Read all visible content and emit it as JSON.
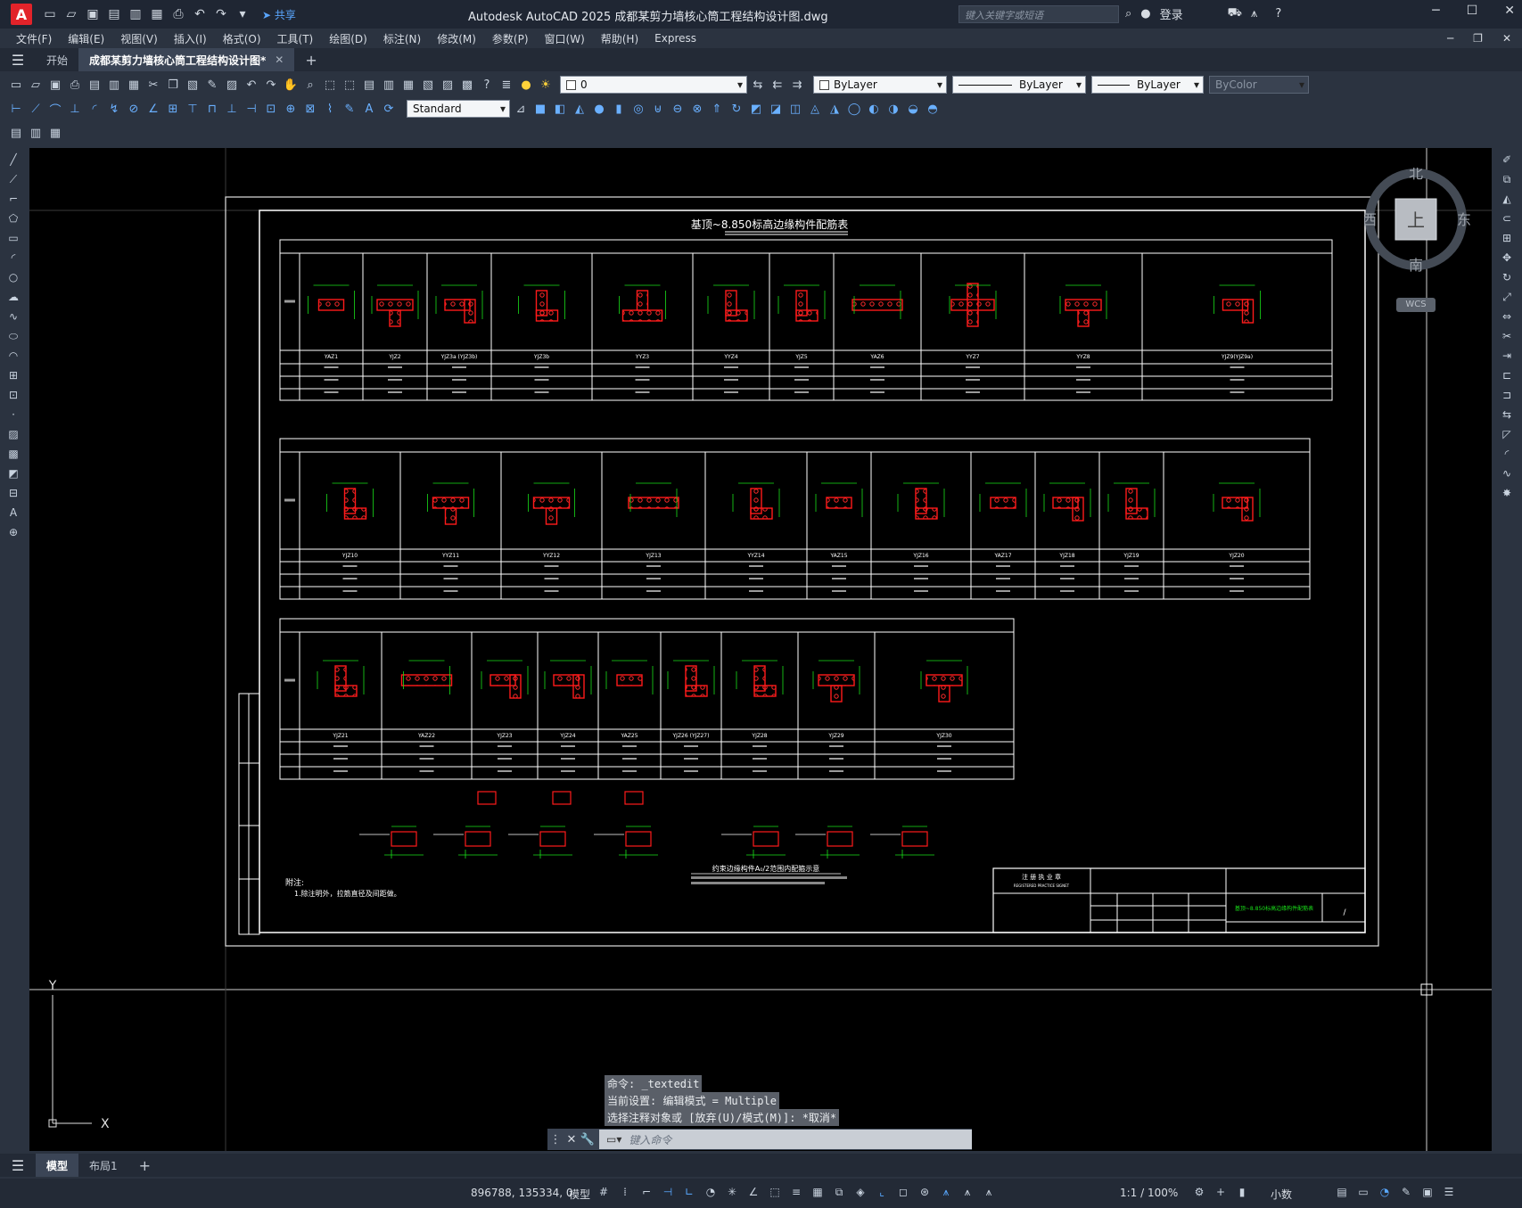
{
  "titlebar": {
    "app_letter": "A",
    "share": "共享",
    "title": "Autodesk AutoCAD 2025    成都某剪力墙核心筒工程结构设计图.dwg",
    "search_placeholder": "键入关键字或短语",
    "login": "登录"
  },
  "menubar": {
    "items": [
      "文件(F)",
      "编辑(E)",
      "视图(V)",
      "插入(I)",
      "格式(O)",
      "工具(T)",
      "绘图(D)",
      "标注(N)",
      "修改(M)",
      "参数(P)",
      "窗口(W)",
      "帮助(H)",
      "Express"
    ]
  },
  "tabs": {
    "start": "开始",
    "document": "成都某剪力墙核心筒工程结构设计图*"
  },
  "toolbar": {
    "layer_value": "0",
    "color_value": "ByLayer",
    "linetype_value": "ByLayer",
    "lineweight_value": "ByLayer",
    "plotstyle_value": "ByColor",
    "dimstyle_value": "Standard"
  },
  "viewcube": {
    "north": "北",
    "south": "南",
    "east": "东",
    "west": "西",
    "top": "上",
    "wcs": "WCS"
  },
  "drawing": {
    "title": "基顶~8.850标高边缘构件配筋表",
    "table1_labels": [
      "YAZ1",
      "YJZ2",
      "YJZ3a",
      "(YJZ3b)",
      "YJZ3b",
      "YYZ3",
      "YYZ4",
      "YJZ5",
      "YAZ6",
      "YYZ7",
      "YYZ8",
      "YJZ9(YJZ9a)"
    ],
    "table2_labels": [
      "YJZ10",
      "YYZ11",
      "YYZ12",
      "YJZ13",
      "YYZ14",
      "YAZ15",
      "YJZ16",
      "YAZ17",
      "YJZ18",
      "YJZ19",
      "YJZ20"
    ],
    "table3_labels": [
      "YJZ21",
      "YAZ22",
      "YJZ23",
      "YJZ24",
      "YAZ25",
      "YJZ26 (YJZ27)",
      "YJZ28",
      "YJZ29",
      "YJZ30"
    ],
    "notes_title": "附注:",
    "notes_body": "1.除注明外，拉筋直径及间距做。",
    "detail_title": "约束边缘构件A₀/2范围内配箍示意",
    "stamp_title": "注 册 执 业 章",
    "stamp_sub": "REGISTERED PRACTICE SIGNET",
    "sheet_title": "基顶~8.850标高边缘构件配筋表"
  },
  "ucs": {
    "x": "X",
    "y": "Y"
  },
  "command": {
    "line1": "命令: _textedit",
    "line2": "当前设置: 编辑模式 = Multiple",
    "line3": "选择注释对象或 [放弃(U)/模式(M)]: *取消*",
    "placeholder": "键入命令"
  },
  "layouts": {
    "model": "模型",
    "layout1": "布局1",
    "add": "+"
  },
  "status": {
    "coords": "896788, 135334, 0",
    "model": "模型",
    "scale": "1:1 / 100%",
    "units": "小数"
  },
  "colors": {
    "accent": "#59a8ff",
    "rebar_red": "#ff1a1a",
    "dim_green": "#19e019",
    "canvas_bg": "#000000"
  }
}
